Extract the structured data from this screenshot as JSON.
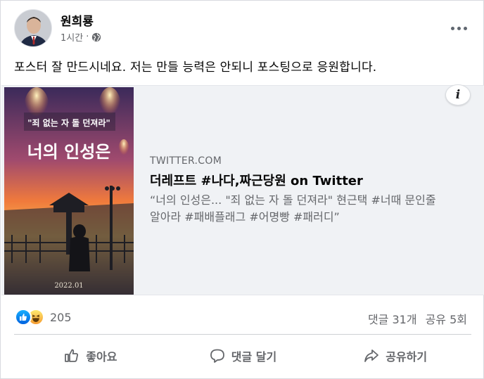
{
  "post": {
    "author": "원희룡",
    "time": "1시간",
    "privacy_icon": "globe-icon",
    "more_icon": "more-options-icon",
    "message": "포스터 잘 만드시네요. 저는 만들 능력은 안되니 포스팅으로 응원합니다."
  },
  "link": {
    "poster_title": "너의 인성은",
    "poster_tagline": "\"죄 없는 자 돌 던져라\"",
    "poster_date": "2022.01",
    "domain": "TWITTER.COM",
    "title": "더레프트 #나다,짜근당원 on Twitter",
    "description": "“너의 인성은... \"죄 없는 자 돌 던져라\" 현근택 #너때 문인줄알아라 #패배플래그 #어명빵 #패러디”",
    "info_icon": "info-icon"
  },
  "engagement": {
    "reaction_count": "205",
    "comments": "댓글 31개",
    "shares": "공유 5회"
  },
  "actions": {
    "like": "좋아요",
    "comment": "댓글 달기",
    "share": "공유하기"
  },
  "colors": {
    "accent": "#1877f2",
    "secondary_text": "#65676b",
    "card_bg": "#f0f2f5"
  }
}
